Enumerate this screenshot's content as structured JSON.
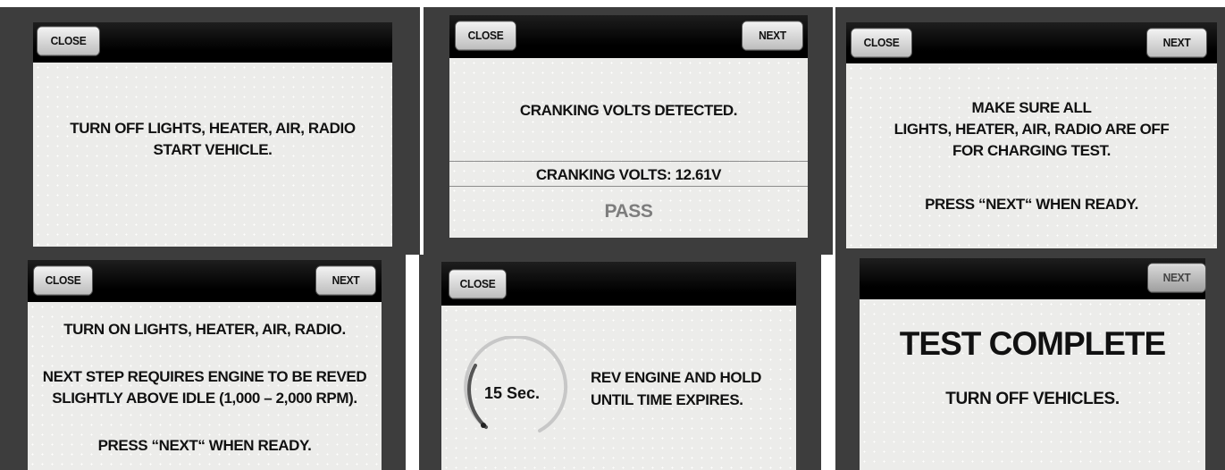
{
  "screens": [
    {
      "close_label": "CLOSE",
      "message": "TURN OFF LIGHTS, HEATER, AIR, RADIO\nSTART VEHICLE."
    },
    {
      "close_label": "CLOSE",
      "next_label": "NEXT",
      "message": "CRANKING VOLTS DETECTED.",
      "reading": "CRANKING VOLTS: 12.61V",
      "result": "PASS"
    },
    {
      "close_label": "CLOSE",
      "next_label": "NEXT",
      "message": "MAKE SURE ALL\nLIGHTS, HEATER, AIR, RADIO ARE OFF\nFOR CHARGING TEST.",
      "prompt": "PRESS “NEXT“ WHEN READY."
    },
    {
      "close_label": "CLOSE",
      "next_label": "NEXT",
      "message": "TURN ON LIGHTS, HEATER, AIR, RADIO.",
      "detail": "NEXT STEP REQUIRES ENGINE TO BE REVED\nSLIGHTLY ABOVE IDLE (1,000 – 2,000 RPM).",
      "prompt": "PRESS “NEXT“ WHEN READY."
    },
    {
      "close_label": "CLOSE",
      "timer": "15 Sec.",
      "message": "REV ENGINE AND HOLD\nUNTIL TIME EXPIRES."
    },
    {
      "next_label": "NEXT",
      "title": "TEST COMPLETE",
      "message": "TURN OFF VEHICLES."
    }
  ]
}
